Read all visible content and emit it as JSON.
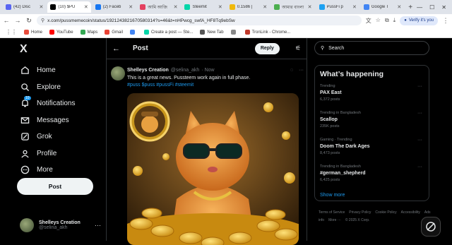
{
  "browser": {
    "tabs": [
      {
        "label": "(42) Disc",
        "color": "#5865f2",
        "active": false
      },
      {
        "label": "(10) $PU",
        "color": "#000000",
        "active": true
      },
      {
        "label": "(2) Faceb",
        "color": "#1877f2",
        "active": false
      },
      {
        "label": "আমি আজি",
        "color": "#e4405f",
        "active": false
      },
      {
        "label": "Steemit",
        "color": "#06d6a9",
        "active": false
      },
      {
        "label": "0.1586 |",
        "color": "#f0b90b",
        "active": false
      },
      {
        "label": "আমার বাংলা",
        "color": "#4caf50",
        "active": false
      },
      {
        "label": "PussFi p",
        "color": "#1da1f2",
        "active": false
      },
      {
        "label": "Google T",
        "color": "#4285f4",
        "active": false
      }
    ],
    "new_tab": "+",
    "url": "x.com/pussmemecoin/status/1921243821670580314?s=46&t=nHPwcg_swfA_HF8Tq9ebSw",
    "translate_label": "English",
    "verify_label": "Verify it's you",
    "bookmarks": [
      {
        "label": "Home",
        "color": "#e74c3c"
      },
      {
        "label": "YouTube",
        "color": "#ff0000"
      },
      {
        "label": "Maps",
        "color": "#34a853"
      },
      {
        "label": "Gmail",
        "color": "#ea4335"
      },
      {
        "label": "",
        "color": "#4285f4"
      },
      {
        "label": "Create a post — Ste...",
        "color": "#06d6a9"
      },
      {
        "label": "New Tab",
        "color": "#555555"
      },
      {
        "label": "",
        "color": "#888888"
      },
      {
        "label": "TronLink - Chrome...",
        "color": "#c0392b"
      }
    ]
  },
  "sidebar": {
    "logo": "X",
    "items": [
      {
        "label": "Home",
        "icon": "home-icon",
        "badge": ""
      },
      {
        "label": "Explore",
        "icon": "search-icon",
        "badge": ""
      },
      {
        "label": "Notifications",
        "icon": "bell-icon",
        "badge": "10"
      },
      {
        "label": "Messages",
        "icon": "mail-icon",
        "badge": ""
      },
      {
        "label": "Grok",
        "icon": "grok-icon",
        "badge": ""
      },
      {
        "label": "Profile",
        "icon": "person-icon",
        "badge": ""
      },
      {
        "label": "More",
        "icon": "more-circle-icon",
        "badge": ""
      }
    ],
    "post_button": "Post",
    "account": {
      "name": "Shelleys Creation",
      "handle": "@selina_akh",
      "more": "···"
    }
  },
  "main": {
    "title": "Post",
    "reply_button": "Reply",
    "tweet": {
      "name": "Shelleys Creation",
      "handle": "@selina_akh",
      "time": "· Now",
      "text": "This is a great news. Pussteem work again in full phase.",
      "tags": "#puss $puss #pussFi #steemit"
    }
  },
  "right": {
    "search_placeholder": "Search",
    "trends_title": "What’s happening",
    "trends": [
      {
        "context": "Trending",
        "title": "PAX East",
        "posts": "6,372 posts"
      },
      {
        "context": "Trending in Bangladesh",
        "title": "Scallop",
        "posts": "235K posts"
      },
      {
        "context": "Gaming · Trending",
        "title": "Doom The Dark Ages",
        "posts": "8,473 posts"
      },
      {
        "context": "Trending in Bangladesh",
        "title": "#german_shepherd",
        "posts": "6,425 posts"
      }
    ],
    "show_more": "Show more",
    "footer": [
      "Terms of Service",
      "Privacy Policy",
      "Cookie Policy",
      "Accessibility",
      "Ads info",
      "More ···",
      "© 2025 X Corp."
    ]
  },
  "colors": {
    "accent": "#1d9bf0",
    "bg": "#000000",
    "text": "#e7e9ea",
    "muted": "#71767b"
  }
}
